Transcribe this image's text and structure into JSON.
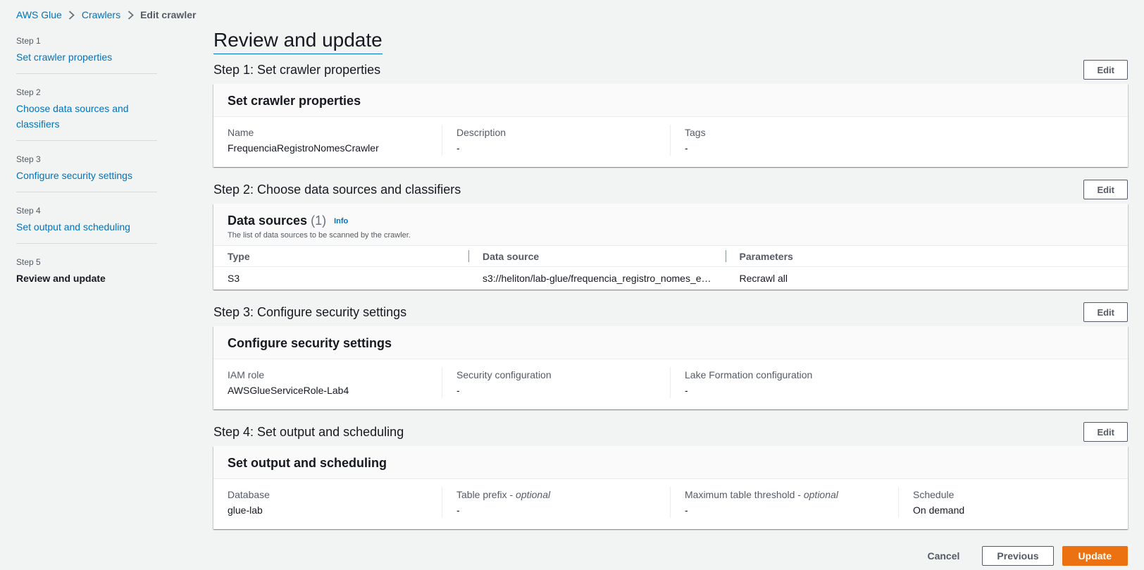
{
  "breadcrumb": {
    "items": [
      "AWS Glue",
      "Crawlers"
    ],
    "current": "Edit crawler"
  },
  "steps": [
    {
      "num": "Step 1",
      "label": "Set crawler properties"
    },
    {
      "num": "Step 2",
      "label": "Choose data sources and classifiers"
    },
    {
      "num": "Step 3",
      "label": "Configure security settings"
    },
    {
      "num": "Step 4",
      "label": "Set output and scheduling"
    },
    {
      "num": "Step 5",
      "label": "Review and update"
    }
  ],
  "main": {
    "title": "Review and update",
    "edit_label": "Edit",
    "step1": {
      "heading": "Step 1: Set crawler properties",
      "card_title": "Set crawler properties",
      "fields": [
        {
          "key": "Name",
          "value": "FrequenciaRegistroNomesCrawler"
        },
        {
          "key": "Description",
          "value": "-"
        },
        {
          "key": "Tags",
          "value": "-"
        }
      ]
    },
    "step2": {
      "heading": "Step 2: Choose data sources and classifiers",
      "card_title": "Data sources",
      "count": "(1)",
      "info": "Info",
      "description": "The list of data sources to be scanned by the crawler.",
      "columns": [
        "Type",
        "Data source",
        "Parameters"
      ],
      "rows": [
        [
          "S3",
          "s3://heliton/lab-glue/frequencia_registro_nomes_e…",
          "Recrawl all"
        ]
      ]
    },
    "step3": {
      "heading": "Step 3: Configure security settings",
      "card_title": "Configure security settings",
      "fields": [
        {
          "key": "IAM role",
          "value": "AWSGlueServiceRole-Lab4"
        },
        {
          "key": "Security configuration",
          "value": "-"
        },
        {
          "key": "Lake Formation configuration",
          "value": "-"
        }
      ]
    },
    "step4": {
      "heading": "Step 4: Set output and scheduling",
      "card_title": "Set output and scheduling",
      "optional": "optional",
      "fields": [
        {
          "key": "Database",
          "value": "glue-lab"
        },
        {
          "key": "Table prefix",
          "value": "-"
        },
        {
          "key": "Maximum table threshold",
          "value": "-"
        },
        {
          "key": "Schedule",
          "value": "On demand"
        }
      ]
    }
  },
  "actions": {
    "cancel": "Cancel",
    "previous": "Previous",
    "update": "Update"
  },
  "colors": {
    "link": "#0073bb",
    "primary": "#ec7211",
    "background": "#f2f3f3"
  }
}
